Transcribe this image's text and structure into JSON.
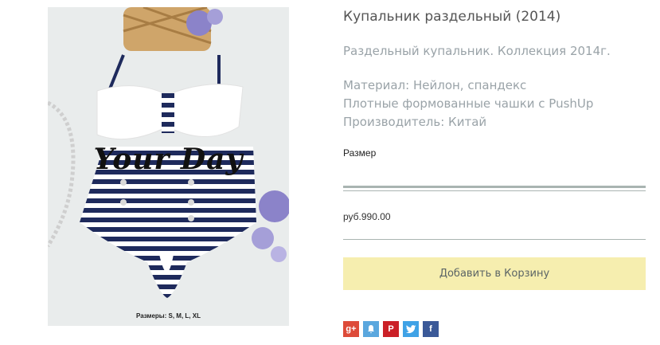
{
  "product": {
    "title": "Купальник раздельный (2014)",
    "description": "Раздельный купальник. Коллекция 2014г.",
    "material": "Материал: Нейлон, спандекс",
    "cups": "Плотные формованные чашки с PushUp",
    "manufacturer": "Производитель: Китай",
    "size_label": "Размер",
    "price": "руб.990.00",
    "add_to_cart_label": "Добавить в Корзину"
  },
  "image": {
    "watermark": "Your Day",
    "sizes_caption": "Размеры: S, M, L, XL"
  },
  "share": [
    {
      "name": "google-plus-icon",
      "glyph": "g+",
      "color": "#dd4b39"
    },
    {
      "name": "bell-icon",
      "glyph": "🔔",
      "color": "#5aa7de"
    },
    {
      "name": "pinterest-icon",
      "glyph": "P",
      "color": "#cb2027"
    },
    {
      "name": "twitter-icon",
      "glyph": "t",
      "color": "#3fa2e6"
    },
    {
      "name": "facebook-icon",
      "glyph": "f",
      "color": "#3b5998"
    }
  ],
  "colors": {
    "accent_button": "#f6eeaf",
    "rule": "#a9b4b1",
    "stripe_navy": "#1e2a5c"
  }
}
